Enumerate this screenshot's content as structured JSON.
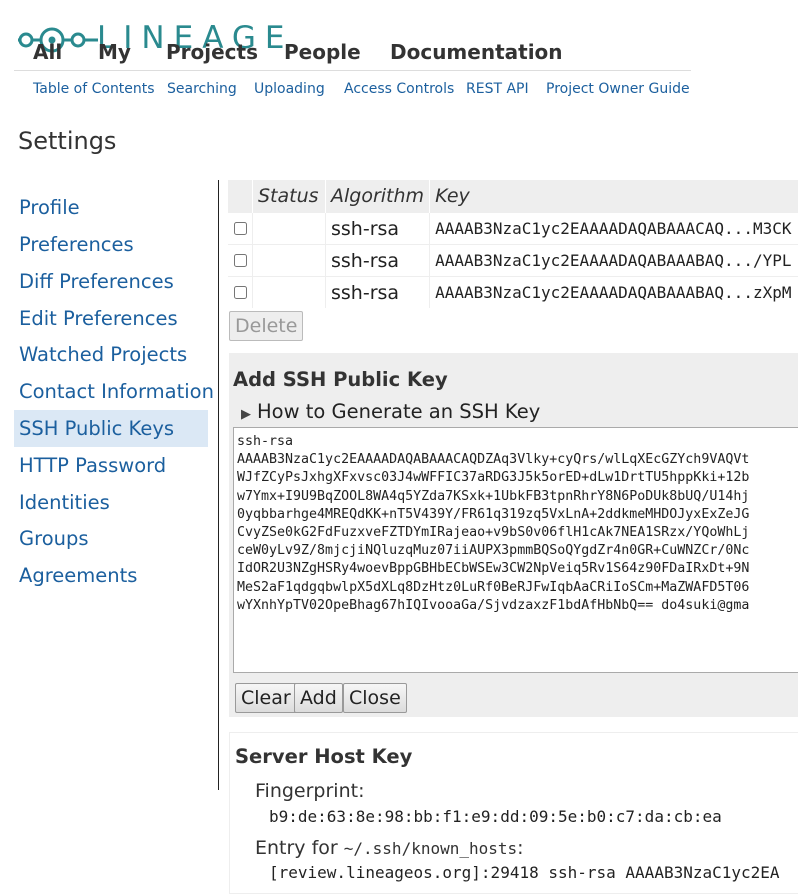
{
  "logo": {
    "text": "LINEAGE"
  },
  "topmenu": [
    "All",
    "My",
    "Projects",
    "People",
    "Documentation"
  ],
  "submenu": [
    "Table of Contents",
    "Searching",
    "Uploading",
    "Access Controls",
    "REST API",
    "Project Owner Guide"
  ],
  "page_title": "Settings",
  "sidebar": {
    "selected": "SSH Public Keys",
    "items": [
      "Profile",
      "Preferences",
      "Diff Preferences",
      "Edit Preferences",
      "Watched Projects",
      "Contact Information",
      "SSH Public Keys",
      "HTTP Password",
      "Identities",
      "Groups",
      "Agreements"
    ]
  },
  "keys_table": {
    "headers": [
      "Status",
      "Algorithm",
      "Key"
    ],
    "rows": [
      {
        "algorithm": "ssh-rsa",
        "key": "AAAAB3NzaC1yc2EAAAADAQABAAACAQ...M3CK"
      },
      {
        "algorithm": "ssh-rsa",
        "key": "AAAAB3NzaC1yc2EAAAADAQABAAABAQ.../YPL"
      },
      {
        "algorithm": "ssh-rsa",
        "key": "AAAAB3NzaC1yc2EAAAADAQABAAABAQ...zXpM"
      }
    ],
    "delete_label": "Delete"
  },
  "add_key": {
    "title": "Add SSH Public Key",
    "howto_label": "How to Generate an SSH Key",
    "textarea_value": "ssh-rsa\nAAAAB3NzaC1yc2EAAAADAQABAAACAQDZAq3Vlky+cyQrs/wlLqXEcGZYch9VAQVt\nWJfZCyPsJxhgXFxvsc03J4wWFFIC37aRDG3J5k5orED+dLw1DrtTU5hppKki+12b\nw7Ymx+I9U9BqZOOL8WA4q5YZda7KSxk+1UbkFB3tpnRhrY8N6PoDUk8bUQ/U14hj\n0yqbbarhge4MREQdKK+nT5V439Y/FR61q319zq5VxLnA+2ddkmeMHDOJyxExZeJG\nCvyZSe0kG2FdFuzxveFZTDYmIRajeao+v9bS0v06flH1cAk7NEA1SRzx/YQoWhLj\nceW0yLv9Z/8mjcjiNQluzqMuz07iiAUPX3pmmBQSoQYgdZr4n0GR+CuWNZCr/0Nc\nIdOR2U3NZgHSRy4woevBppGBHbECbWSEw3CW2NpVeiq5Rv1S64z90FDaIRxDt+9N\nMeS2aF1qdgqbwlpX5dXLq8DzHtz0LuRf0BeRJFwIqbAaCRiIoSCm+MaZWAFD5T06\nwYXnhYpTV02OpeBhag67hIQIvooaGa/SjvdzaxzF1bdAfHbNbQ== do4suki@gma",
    "buttons": {
      "clear": "Clear",
      "add": "Add",
      "close": "Close"
    }
  },
  "server_host_key": {
    "title": "Server Host Key",
    "fingerprint_label": "Fingerprint:",
    "fingerprint": "b9:de:63:8e:98:bb:f1:e9:dd:09:5e:b0:c7:da:cb:ea",
    "entry_label_prefix": "Entry for",
    "entry_label_path": "~/.ssh/known_hosts",
    "entry_label_suffix": ":",
    "entry_value": "[review.lineageos.org]:29418 ssh-rsa AAAAB3NzaC1yc2EA"
  },
  "colors": {
    "brand": "#2a8a8f",
    "link": "#1b5f9e",
    "selected_bg": "#dbe8f5",
    "panel_bg": "#eeeeee"
  }
}
